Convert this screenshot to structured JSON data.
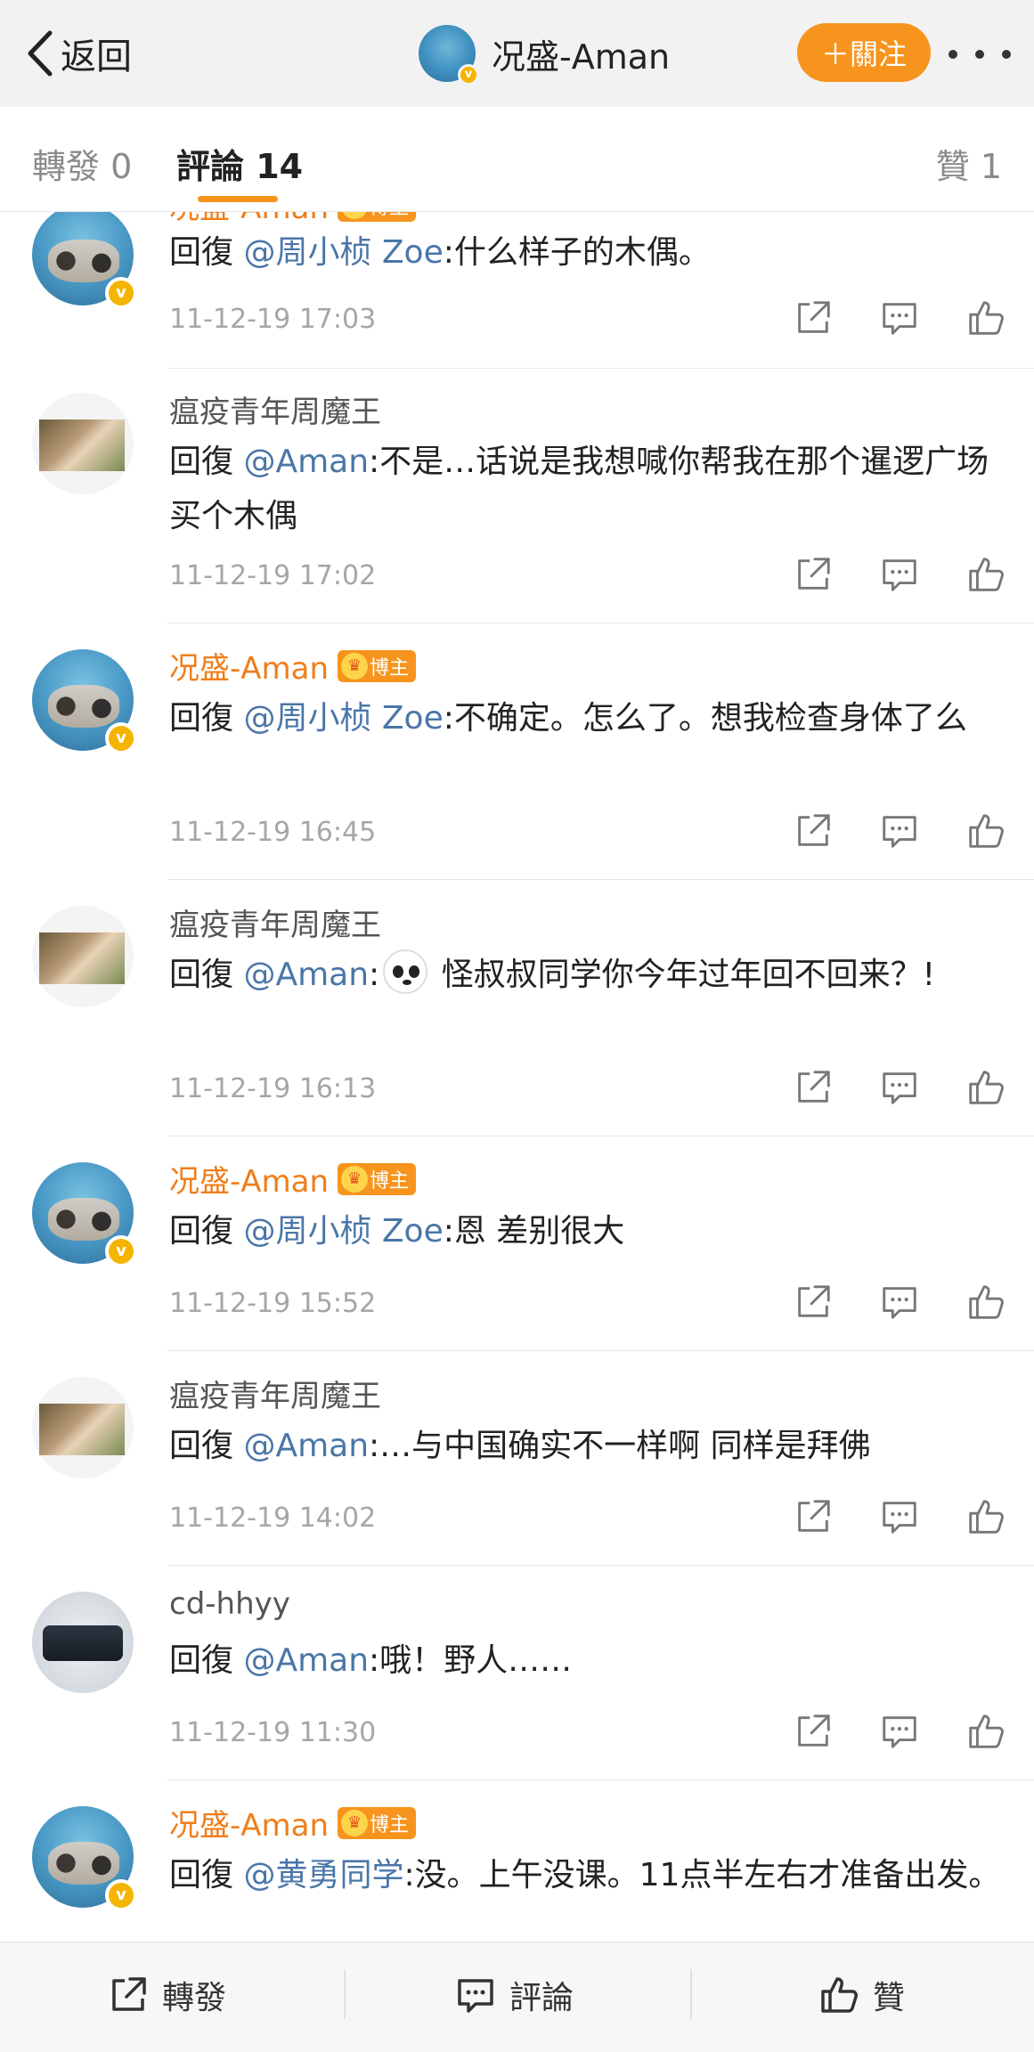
{
  "nav": {
    "back_label": "返回",
    "title": "况盛-Aman",
    "verified": "v",
    "follow_label": "＋關注"
  },
  "tabs": {
    "repost": "轉發 0",
    "comments": "評論 14",
    "likes": "贊 1"
  },
  "comments": [
    {
      "author": "况盛-Aman",
      "author_type": "blogger",
      "badge": "博主",
      "avatar": "aman",
      "mention": "@周小桢 Zoe",
      "prefix": "回復 ",
      "text": ":什么样子的木偶。",
      "time": "11-12-19 17:03"
    },
    {
      "author": "瘟疫青年周魔王",
      "author_type": "normal",
      "badge": "",
      "avatar": "zhou",
      "mention": "@Aman",
      "prefix": "回復 ",
      "text": ":不是…话说是我想喊你帮我在那个暹逻广场买个木偶",
      "time": "11-12-19 17:02"
    },
    {
      "author": "况盛-Aman",
      "author_type": "blogger",
      "badge": "博主",
      "avatar": "aman",
      "mention": "@周小桢 Zoe",
      "prefix": "回復 ",
      "text": ":不确定。怎么了。想我检查身体了么",
      "time": "11-12-19 16:45"
    },
    {
      "author": "瘟疫青年周魔王",
      "author_type": "normal",
      "badge": "",
      "avatar": "zhou",
      "mention": "@Aman",
      "prefix": "回復 ",
      "text": " 怪叔叔同学你今年过年回不回来？!",
      "emoji": "panda-emoji",
      "time": "11-12-19 16:13"
    },
    {
      "author": "况盛-Aman",
      "author_type": "blogger",
      "badge": "博主",
      "avatar": "aman",
      "mention": "@周小桢 Zoe",
      "prefix": "回復 ",
      "text": ":恩 差别很大",
      "time": "11-12-19 15:52"
    },
    {
      "author": "瘟疫青年周魔王",
      "author_type": "normal",
      "badge": "",
      "avatar": "zhou",
      "mention": "@Aman",
      "prefix": "回復 ",
      "text": ":…与中国确实不一样啊 同样是拜佛",
      "time": "11-12-19 14:02"
    },
    {
      "author": "cd-hhyy",
      "author_type": "normal",
      "badge": "",
      "avatar": "cd",
      "mention": "@Aman",
      "prefix": "回復 ",
      "text": ":哦！野人……",
      "time": "11-12-19 11:30"
    },
    {
      "author": "况盛-Aman",
      "author_type": "blogger",
      "badge": "博主",
      "avatar": "aman",
      "mention": "@黄勇同学",
      "prefix": "回復 ",
      "text": ":没。上午没课。11点半左右才准备出发。",
      "time": ""
    }
  ],
  "bottom": {
    "repost": "轉發",
    "comment": "評論",
    "like": "贊"
  },
  "colors": {
    "accent": "#f7941d",
    "mention": "#4a76a8",
    "blogger_name": "#ef7e1b",
    "timestamp": "#a6a6a6"
  }
}
